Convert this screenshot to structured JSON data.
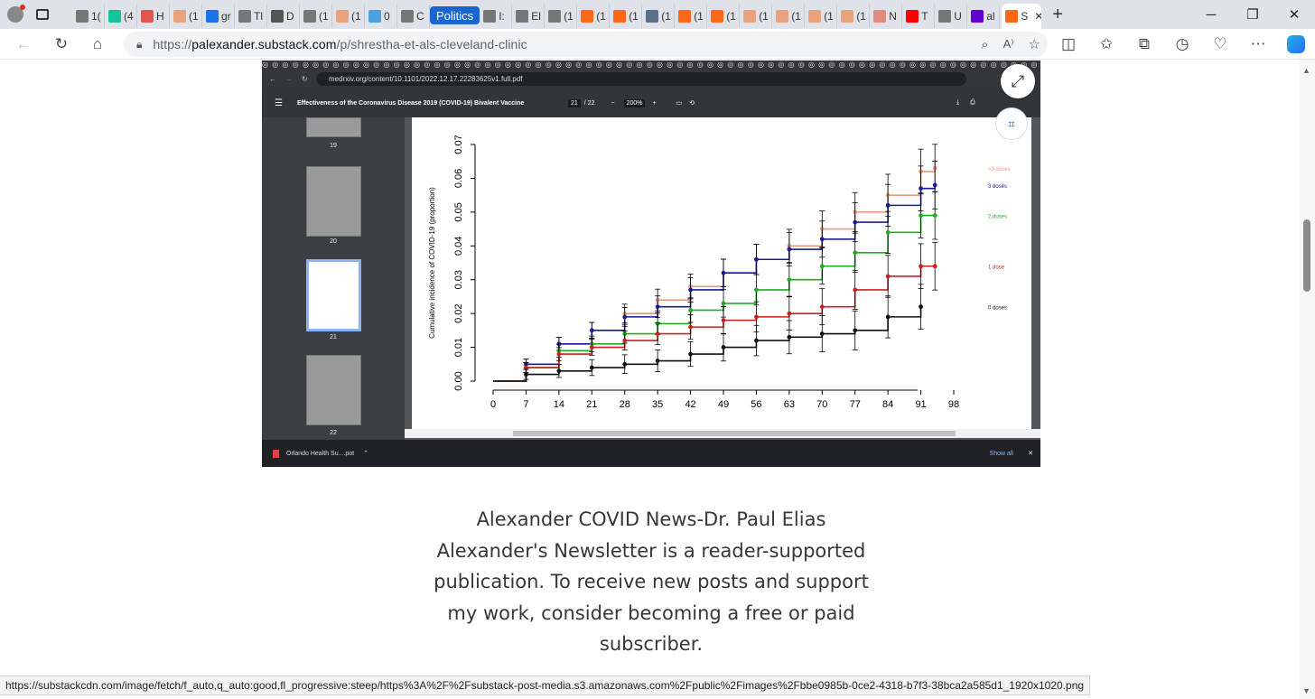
{
  "browser": {
    "tabs": [
      {
        "label": "1(",
        "icon": "page-icon",
        "color": "#777777"
      },
      {
        "label": "(4",
        "icon": "grammarly-icon",
        "color": "#15c39a"
      },
      {
        "label": "H",
        "icon": "download-icon",
        "color": "#e0574f"
      },
      {
        "label": "(1",
        "icon": "substack-icon",
        "color": "#e8a27c"
      },
      {
        "label": "gr",
        "icon": "search-icon",
        "color": "#1a73e8"
      },
      {
        "label": "Tl",
        "icon": "page-icon",
        "color": "#777777"
      },
      {
        "label": "D",
        "icon": "bookmark-icon",
        "color": "#555555"
      },
      {
        "label": "(1",
        "icon": "page-icon",
        "color": "#777777"
      },
      {
        "label": "(1",
        "icon": "substack-icon",
        "color": "#e8a27c"
      },
      {
        "label": "0",
        "icon": "chat-icon",
        "color": "#4aa3df"
      },
      {
        "label": "C",
        "icon": "page-icon",
        "color": "#777777"
      }
    ],
    "group_label": "Politics",
    "tabs_after": [
      {
        "label": "I:",
        "icon": "page-icon",
        "color": "#777777"
      },
      {
        "label": "El",
        "icon": "page-icon",
        "color": "#777777"
      },
      {
        "label": "(1",
        "icon": "page-icon",
        "color": "#777777"
      },
      {
        "label": "(1",
        "icon": "substack-icon",
        "color": "#ff6719"
      },
      {
        "label": "(1",
        "icon": "substack-icon",
        "color": "#ff6719"
      },
      {
        "label": "(1",
        "icon": "avatar-icon",
        "color": "#5a6f8a"
      },
      {
        "label": "(1",
        "icon": "substack-icon",
        "color": "#ff6719"
      },
      {
        "label": "(1",
        "icon": "substack-icon",
        "color": "#ff6719"
      },
      {
        "label": "(1",
        "icon": "substack-icon",
        "color": "#e8a27c"
      },
      {
        "label": "(1",
        "icon": "substack-icon",
        "color": "#e8a27c"
      },
      {
        "label": "(1",
        "icon": "substack-icon",
        "color": "#e8a27c"
      },
      {
        "label": "(1",
        "icon": "substack-icon",
        "color": "#e8a27c"
      },
      {
        "label": "N",
        "icon": "letter-icon",
        "color": "#e08a80"
      },
      {
        "label": "T",
        "icon": "youtube-icon",
        "color": "#ff0000"
      },
      {
        "label": "U",
        "icon": "page-icon",
        "color": "#777777"
      },
      {
        "label": "al",
        "icon": "yahoo-icon",
        "color": "#6001d2"
      }
    ],
    "active_tab": {
      "label": "S",
      "icon": "substack-icon"
    },
    "address": {
      "domain": "palexander.substack.com",
      "scheme": "https://",
      "path": "/p/shrestha-et-als-cleveland-clinic"
    }
  },
  "embedded": {
    "url": "medrxiv.org/content/10.1101/2022.12.17.22283625v1.full.pdf",
    "pdf_title": "Effectiveness of the Coronavirus Disease 2019 (COVID-19) Bivalent Vaccine",
    "page_current": "21",
    "page_total": "/ 22",
    "zoom": "200%",
    "thumbs": [
      "19",
      "20",
      "21",
      "22"
    ],
    "download_name": "Orlando Health Su....pot",
    "show_all": "Show all"
  },
  "chart_data": {
    "type": "line",
    "ylabel": "Cumulative incidence of COVID-19 (proportion)",
    "xlabel": "",
    "x_ticks": [
      "0",
      "7",
      "14",
      "21",
      "28",
      "35",
      "42",
      "49",
      "56",
      "63",
      "70",
      "77",
      "84",
      "91",
      "98"
    ],
    "y_ticks": [
      "0.00",
      "0.01",
      "0.02",
      "0.03",
      "0.04",
      "0.05",
      "0.06",
      "0.07"
    ],
    "xlim": [
      0,
      98
    ],
    "ylim": [
      0,
      0.07
    ],
    "series": [
      {
        "name": ">3 doses",
        "color": "#e39b7c",
        "x": [
          0,
          7,
          14,
          21,
          28,
          35,
          42,
          49,
          56,
          63,
          70,
          77,
          84,
          91,
          94
        ],
        "y": [
          0,
          0.005,
          0.011,
          0.015,
          0.02,
          0.024,
          0.028,
          0.032,
          0.036,
          0.04,
          0.045,
          0.05,
          0.055,
          0.062,
          0.063
        ]
      },
      {
        "name": "3 doses",
        "color": "#1a1a9a",
        "x": [
          0,
          7,
          14,
          21,
          28,
          35,
          42,
          49,
          56,
          63,
          70,
          77,
          84,
          91,
          94
        ],
        "y": [
          0,
          0.005,
          0.011,
          0.015,
          0.019,
          0.022,
          0.027,
          0.032,
          0.036,
          0.039,
          0.042,
          0.047,
          0.052,
          0.057,
          0.058
        ]
      },
      {
        "name": "2 doses",
        "color": "#1fae1f",
        "x": [
          0,
          7,
          14,
          21,
          28,
          35,
          42,
          49,
          56,
          63,
          70,
          77,
          84,
          91,
          94
        ],
        "y": [
          0,
          0.004,
          0.009,
          0.011,
          0.014,
          0.017,
          0.021,
          0.023,
          0.027,
          0.03,
          0.034,
          0.038,
          0.044,
          0.049,
          0.049
        ]
      },
      {
        "name": "1 dose",
        "color": "#cc1f1f",
        "x": [
          0,
          7,
          14,
          21,
          28,
          35,
          42,
          49,
          56,
          63,
          70,
          77,
          84,
          91,
          94
        ],
        "y": [
          0,
          0.004,
          0.008,
          0.01,
          0.012,
          0.014,
          0.016,
          0.018,
          0.019,
          0.02,
          0.022,
          0.027,
          0.031,
          0.034,
          0.034
        ]
      },
      {
        "name": "0 doses",
        "color": "#111111",
        "x": [
          0,
          7,
          14,
          21,
          28,
          35,
          42,
          49,
          56,
          63,
          70,
          77,
          84,
          91
        ],
        "y": [
          0,
          0.002,
          0.003,
          0.004,
          0.005,
          0.006,
          0.008,
          0.01,
          0.012,
          0.013,
          0.014,
          0.015,
          0.019,
          0.022
        ]
      }
    ]
  },
  "caption": {
    "lines": [
      "Alexander COVID News-Dr. Paul Elias",
      "Alexander's Newsletter is a reader-supported",
      "publication. To receive new posts and support",
      "my work, consider becoming a free or paid",
      "subscriber."
    ]
  },
  "status_url": "https://substackcdn.com/image/fetch/f_auto,q_auto:good,fl_progressive:steep/https%3A%2F%2Fsubstack-post-media.s3.amazonaws.com%2Fpublic%2Fimages%2Fbbe0985b-0ce2-4318-b7f3-38bca2a585d1_1920x1020.png"
}
